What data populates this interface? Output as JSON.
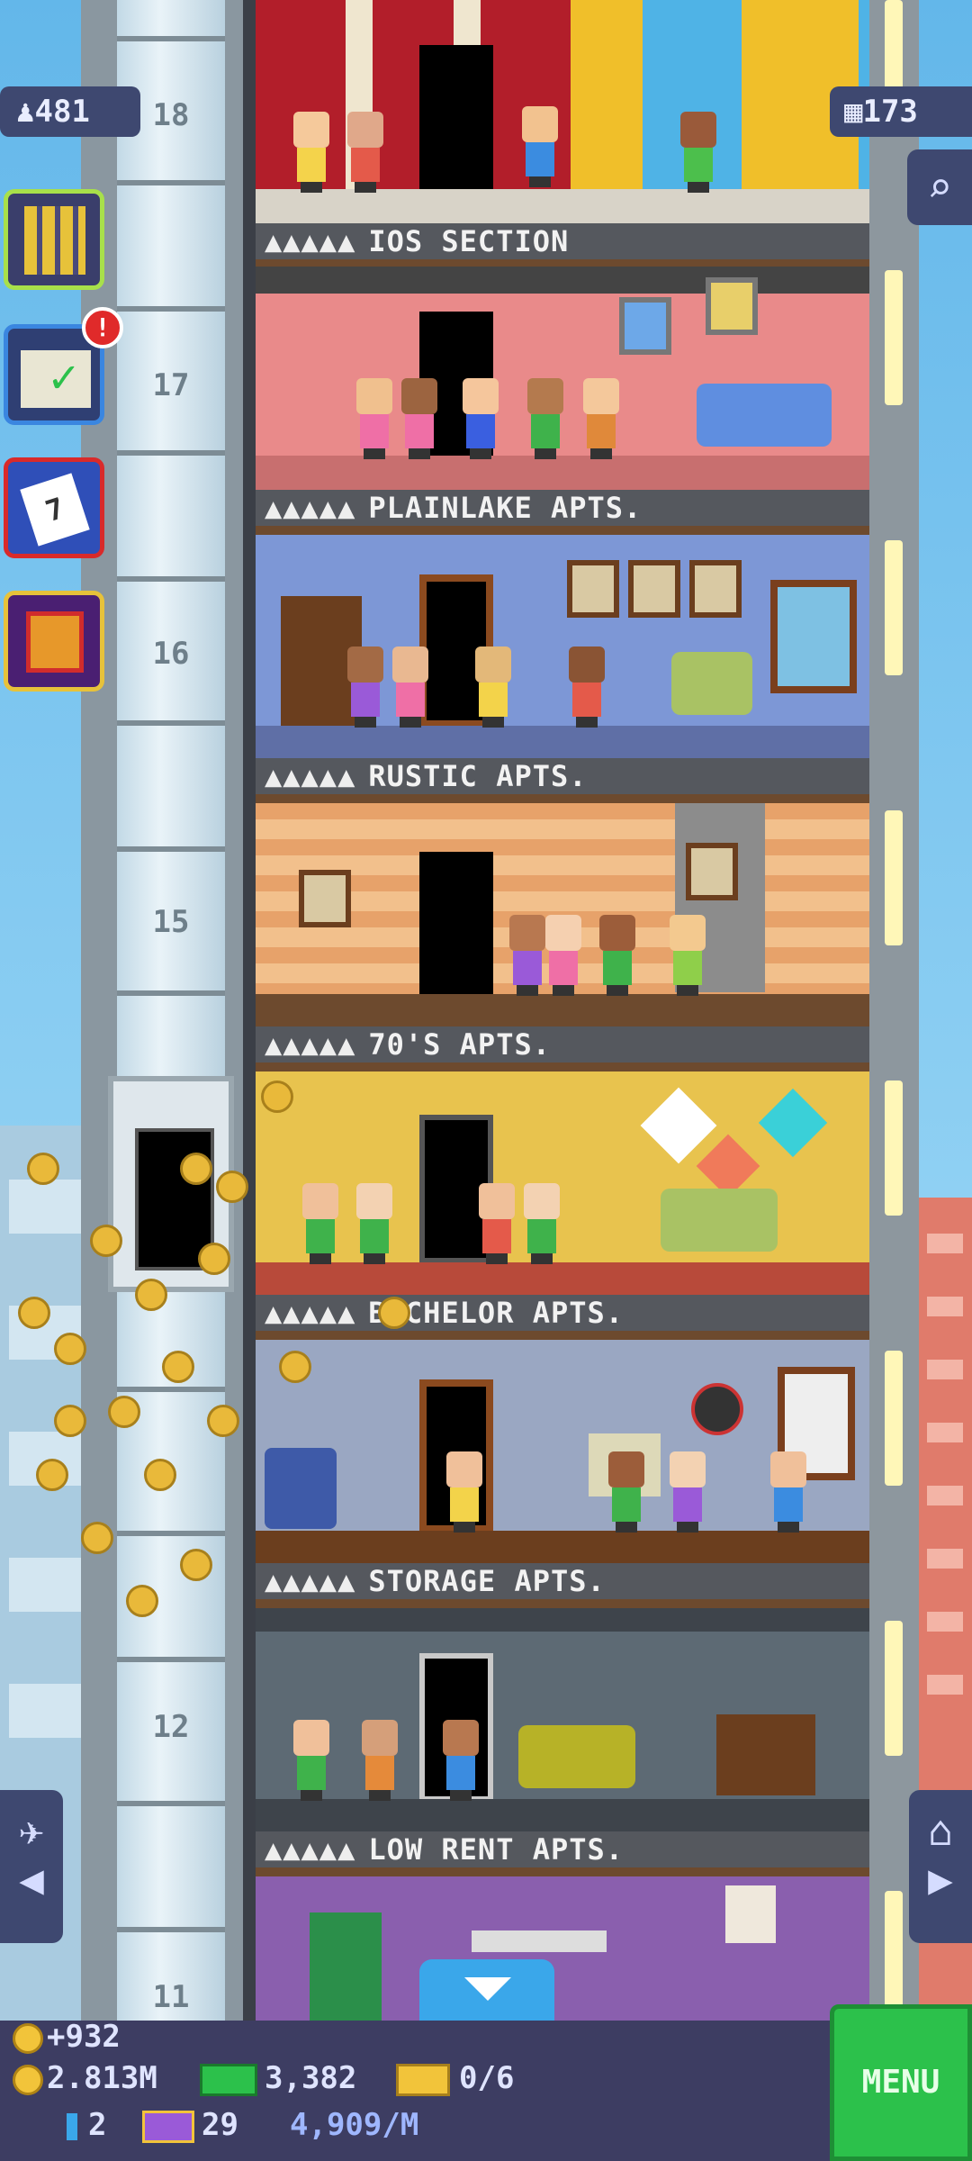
{
  "top": {
    "population": "481",
    "bux_count": "173"
  },
  "elevator": {
    "floor_numbers": [
      "18",
      "17",
      "16",
      "15",
      "12",
      "11"
    ]
  },
  "floors": [
    {
      "label": "IOS SECTION"
    },
    {
      "label": "PLAINLAKE APTS."
    },
    {
      "label": "RUSTIC APTS."
    },
    {
      "label": "70'S APTS."
    },
    {
      "label": "BACHELOR APTS."
    },
    {
      "label": "STORAGE APTS."
    },
    {
      "label": "LOW RENT APTS."
    }
  ],
  "floor_dots": "▲▲▲▲▲",
  "side_buttons": {
    "notification_badge": "!",
    "calendar_day": "7"
  },
  "hud": {
    "coin_gain": "+932",
    "coins": "2.813M",
    "bux": "3,382",
    "vip": "0/6",
    "tower_bux": "2",
    "golden_tickets": "29",
    "income": "4,909/M",
    "menu_label": "MENU"
  },
  "colors": {
    "hud_bg": "#3d3d62",
    "menu_green": "#2cc14b",
    "label_bar": "#55585e"
  }
}
